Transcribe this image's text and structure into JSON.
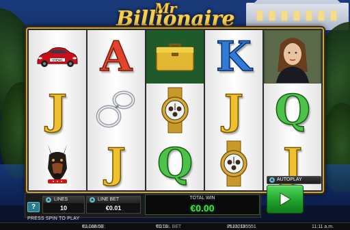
{
  "game": {
    "title_prefix": "Mr",
    "title_main": "Billionaire"
  },
  "reels": [
    [
      "red-sports-car",
      "J",
      "doberman"
    ],
    [
      "A",
      "handcuffs",
      "J"
    ],
    [
      "briefcase",
      "gold-watch",
      "Q"
    ],
    [
      "K",
      "J",
      "gold-watch"
    ],
    [
      "woman-portrait",
      "Q",
      "J"
    ]
  ],
  "controls": {
    "help_label": "?",
    "lines_label": "LINES",
    "lines_value": "10",
    "line_bet_label": "LINE BET",
    "line_bet_value": "€0.01",
    "total_win_label": "TOTAL WIN",
    "total_win_value": "€0.00",
    "autoplay_label": "AUTOPLAY",
    "press_spin_text": "PRESS SPIN TO PLAY"
  },
  "status_bar": {
    "balance_label": "BALANCE:",
    "balance_value": "€1,008.50",
    "total_bet_label": "TOTAL BET",
    "total_bet_value": "€0.10",
    "play_id_label": "PLAY ID",
    "play_id_value": "25132185551",
    "time": "11:11 a.m."
  },
  "colors": {
    "frame_gold": "#c9a44a",
    "win_green": "#3be34e",
    "spin_green": "#20a32b"
  }
}
